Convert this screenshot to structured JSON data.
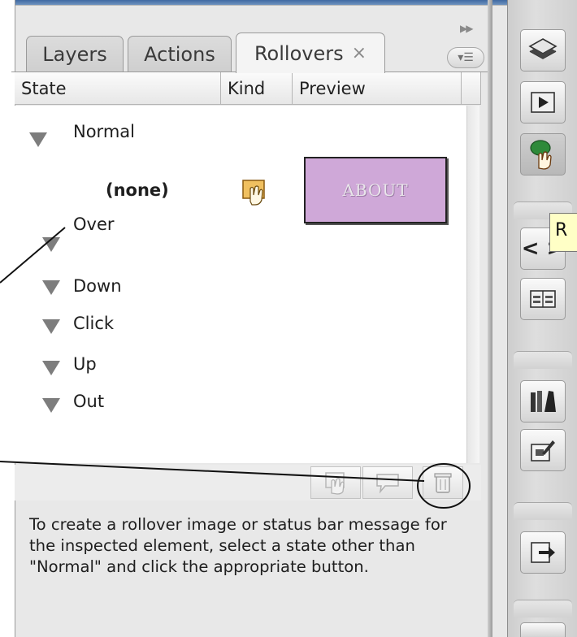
{
  "tabs": [
    {
      "label": "Layers"
    },
    {
      "label": "Actions"
    },
    {
      "label": "Rollovers",
      "close": "×"
    }
  ],
  "columns": [
    "State",
    "Kind",
    "Preview"
  ],
  "states": [
    {
      "label": "Normal"
    },
    {
      "label": "Over"
    },
    {
      "label": "Down"
    },
    {
      "label": "Click"
    },
    {
      "label": "Up"
    },
    {
      "label": "Out"
    }
  ],
  "normal_row": {
    "state_text": "(none)",
    "preview_text": "ABOUT"
  },
  "help_text": "To create a rollover image or status bar message for the inspected element, select a state other than \"Normal\" and click the appropriate button.",
  "tooltip": "R",
  "colors": {
    "preview_fill": "#cfa8d8",
    "panel_bg": "#e8e8e8"
  },
  "icons": {
    "panel_menu": "panel-menu-icon",
    "toolbar": [
      "rollover-image-icon",
      "status-message-icon",
      "trash-icon"
    ],
    "dock": [
      "layers-icon",
      "actions-icon",
      "rollovers-icon",
      "code-icon",
      "table-icon",
      "library-icon",
      "edit-icon",
      "export-icon"
    ]
  }
}
